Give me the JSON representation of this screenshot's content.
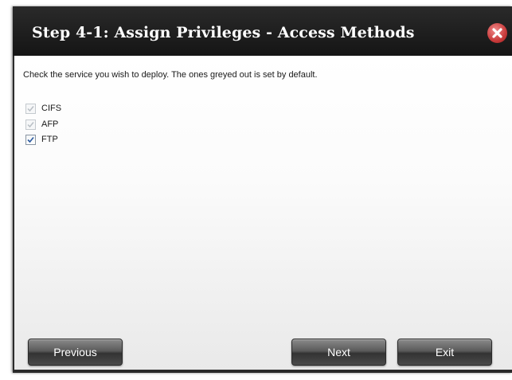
{
  "dialog": {
    "title": "Step 4-1: Assign Privileges - Access Methods",
    "close_icon": "close-icon",
    "instruction": "Check the service you wish to deploy. The ones greyed out is set by default.",
    "options": [
      {
        "label": "CIFS",
        "checked": true,
        "disabled": true
      },
      {
        "label": "AFP",
        "checked": true,
        "disabled": true
      },
      {
        "label": "FTP",
        "checked": true,
        "disabled": false
      }
    ],
    "buttons": {
      "previous": "Previous",
      "next": "Next",
      "exit": "Exit"
    }
  },
  "colors": {
    "titlebar": "#1e1e1e",
    "close": "#c93b3b",
    "button": "#4a4a4a",
    "content_bg": "#fbfbfb"
  }
}
